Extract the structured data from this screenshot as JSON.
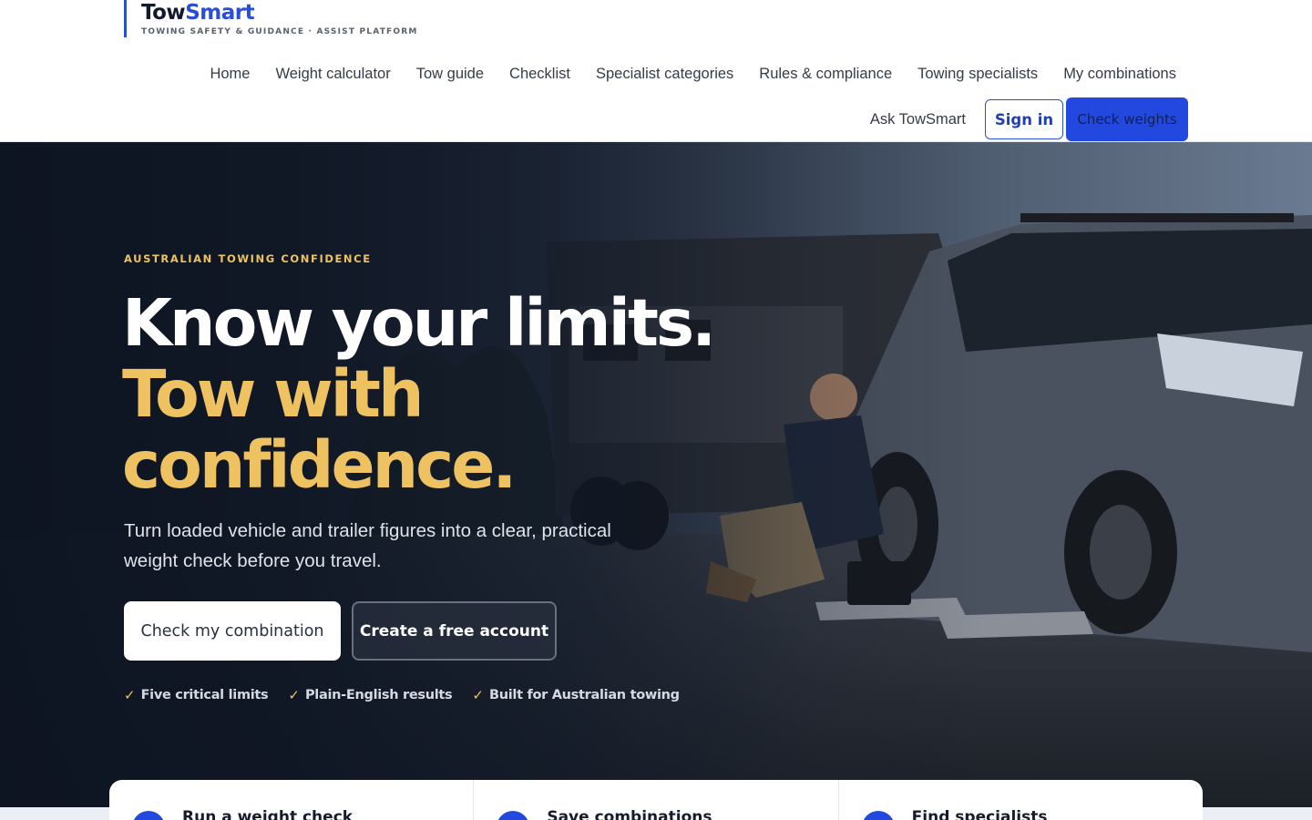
{
  "brand": {
    "name_part1": "Tow",
    "name_part2": "Smart",
    "tagline": "TOWING SAFETY & GUIDANCE · ASSIST PLATFORM"
  },
  "nav": {
    "items": [
      {
        "label": "Home"
      },
      {
        "label": "Weight calculator"
      },
      {
        "label": "Tow guide"
      },
      {
        "label": "Checklist"
      },
      {
        "label": "Specialist categories"
      },
      {
        "label": "Rules & compliance"
      },
      {
        "label": "Towing specialists"
      },
      {
        "label": "My combinations"
      }
    ],
    "ask": "Ask TowSmart",
    "signin": "Sign in",
    "check_weights": "Check weights"
  },
  "hero": {
    "eyebrow": "AUSTRALIAN TOWING CONFIDENCE",
    "headline_line1": "Know your limits.",
    "headline_line2": "Tow with confidence.",
    "subtitle": "Turn loaded vehicle and trailer figures into a clear, practical weight check before you travel.",
    "primary_cta": "Check my combination",
    "secondary_cta": "Create a free account",
    "checks": [
      {
        "tick": "✓",
        "label": "Five critical limits"
      },
      {
        "tick": "✓",
        "label": "Plain-English results"
      },
      {
        "tick": "✓",
        "label": "Built for Australian towing"
      }
    ],
    "photo_icon": "car-trailer-scales-photo"
  },
  "features": [
    {
      "title": "Run a weight check"
    },
    {
      "title": "Save combinations"
    },
    {
      "title": "Find specialists"
    }
  ],
  "colors": {
    "brand_blue": "#2a4fd6",
    "cta_blue": "#2348e0",
    "gold": "#efc261",
    "hero_dark": "#0f1624"
  }
}
